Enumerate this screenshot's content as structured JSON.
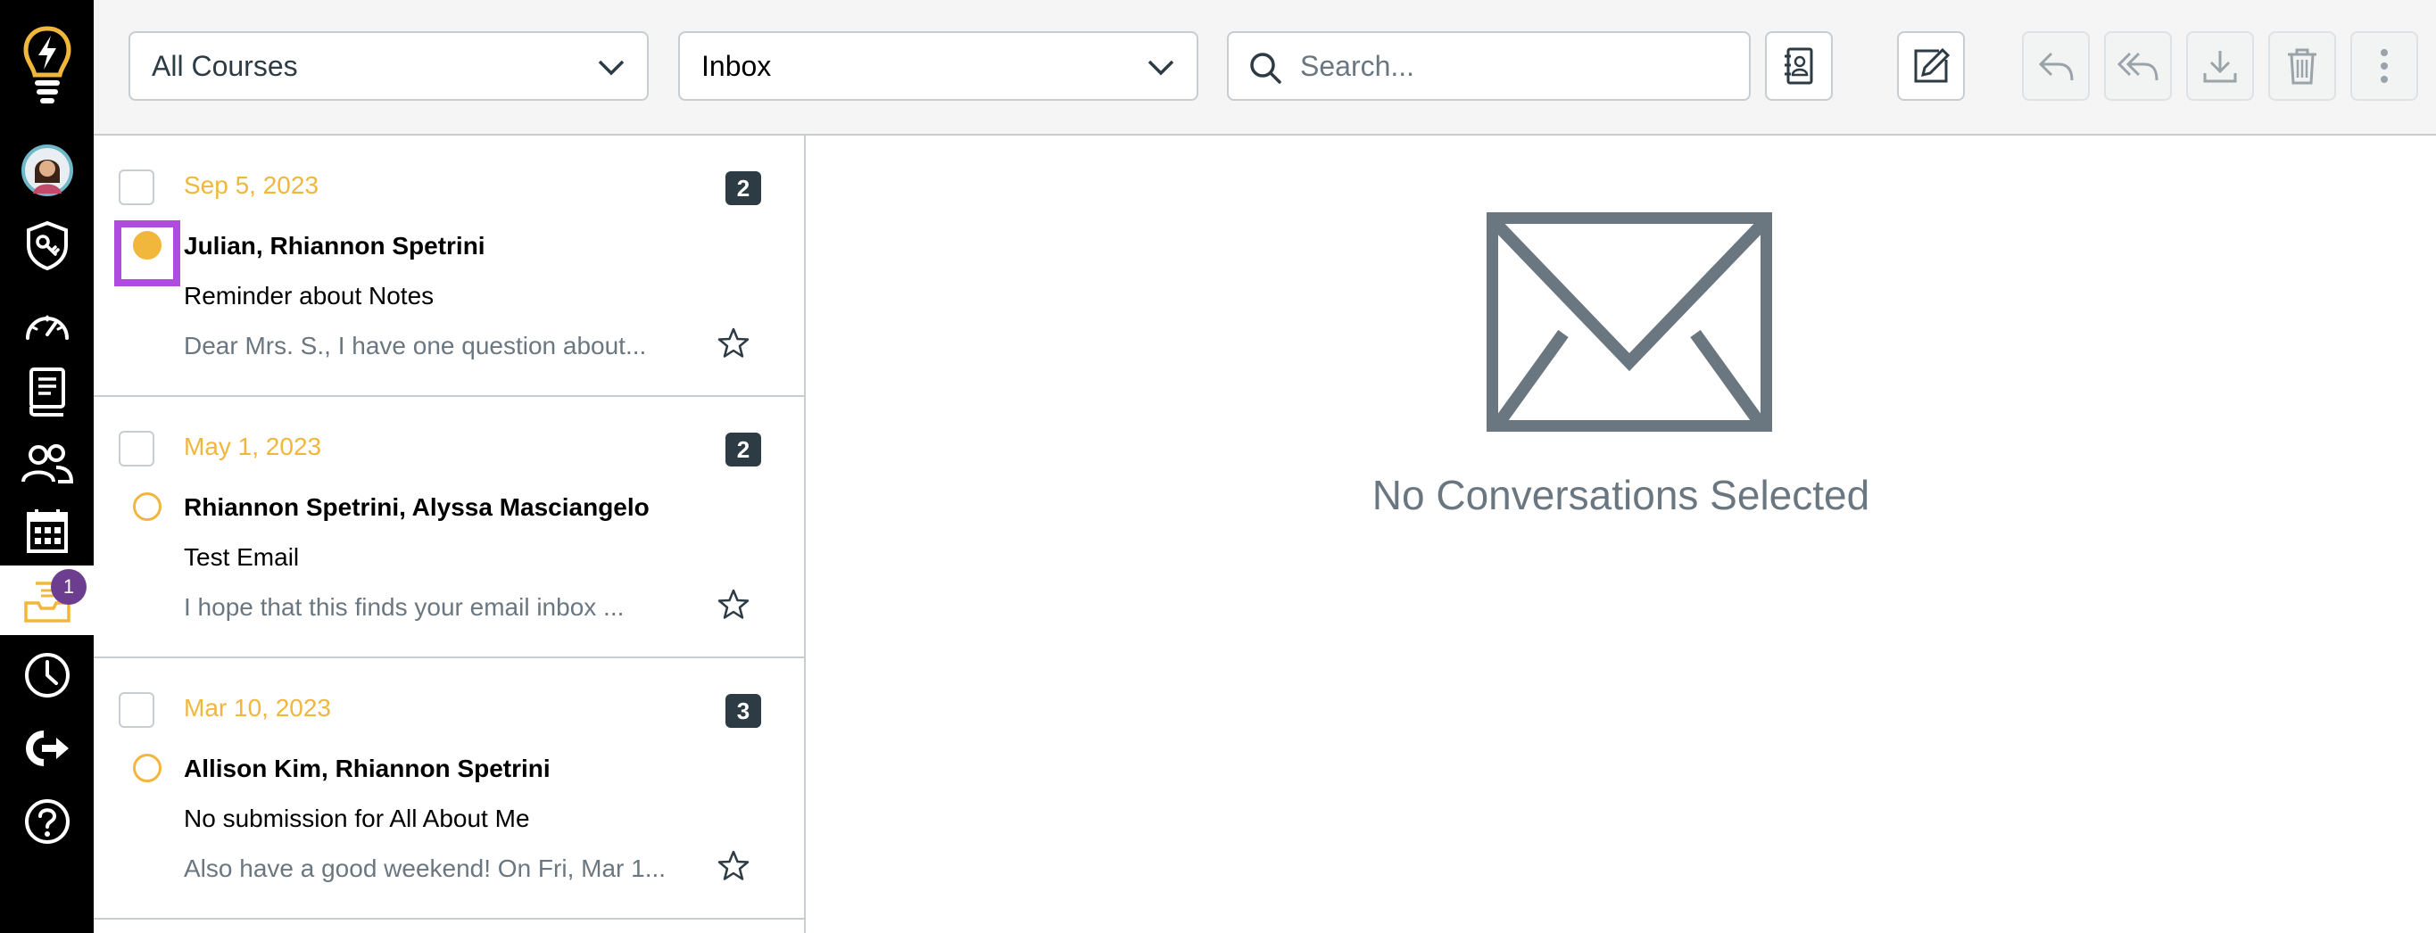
{
  "nav": {
    "inbox_badge": "1",
    "items": [
      "logo-icon",
      "account-avatar",
      "admin-icon",
      "dashboard-icon",
      "courses-icon",
      "groups-icon",
      "calendar-icon",
      "inbox-icon",
      "history-icon",
      "commons-icon",
      "help-icon"
    ]
  },
  "toolbar": {
    "course_select": "All Courses",
    "mailbox_select": "Inbox",
    "search_placeholder": "Search..."
  },
  "conversations": [
    {
      "date": "Sep 5, 2023",
      "count": "2",
      "participants": "Julian, Rhiannon Spetrini",
      "subject": "Reminder about Notes",
      "preview": "Dear Mrs. S., I have one question about...",
      "unread": true
    },
    {
      "date": "May 1, 2023",
      "count": "2",
      "participants": "Rhiannon Spetrini, Alyssa Masciangelo",
      "subject": "Test Email",
      "preview": "I hope that this finds your email inbox ...",
      "unread": false
    },
    {
      "date": "Mar 10, 2023",
      "count": "3",
      "participants": "Allison Kim, Rhiannon Spetrini",
      "subject": "No submission for All About Me",
      "preview": "Also have a good weekend! On Fri, Mar 1...",
      "unread": false
    }
  ],
  "detail": {
    "empty_message": "No Conversations Selected"
  },
  "colors": {
    "accent": "#f0b73c",
    "nav_bg": "#000000",
    "badge": "#6d3d8f",
    "highlight": "#b04be0"
  }
}
